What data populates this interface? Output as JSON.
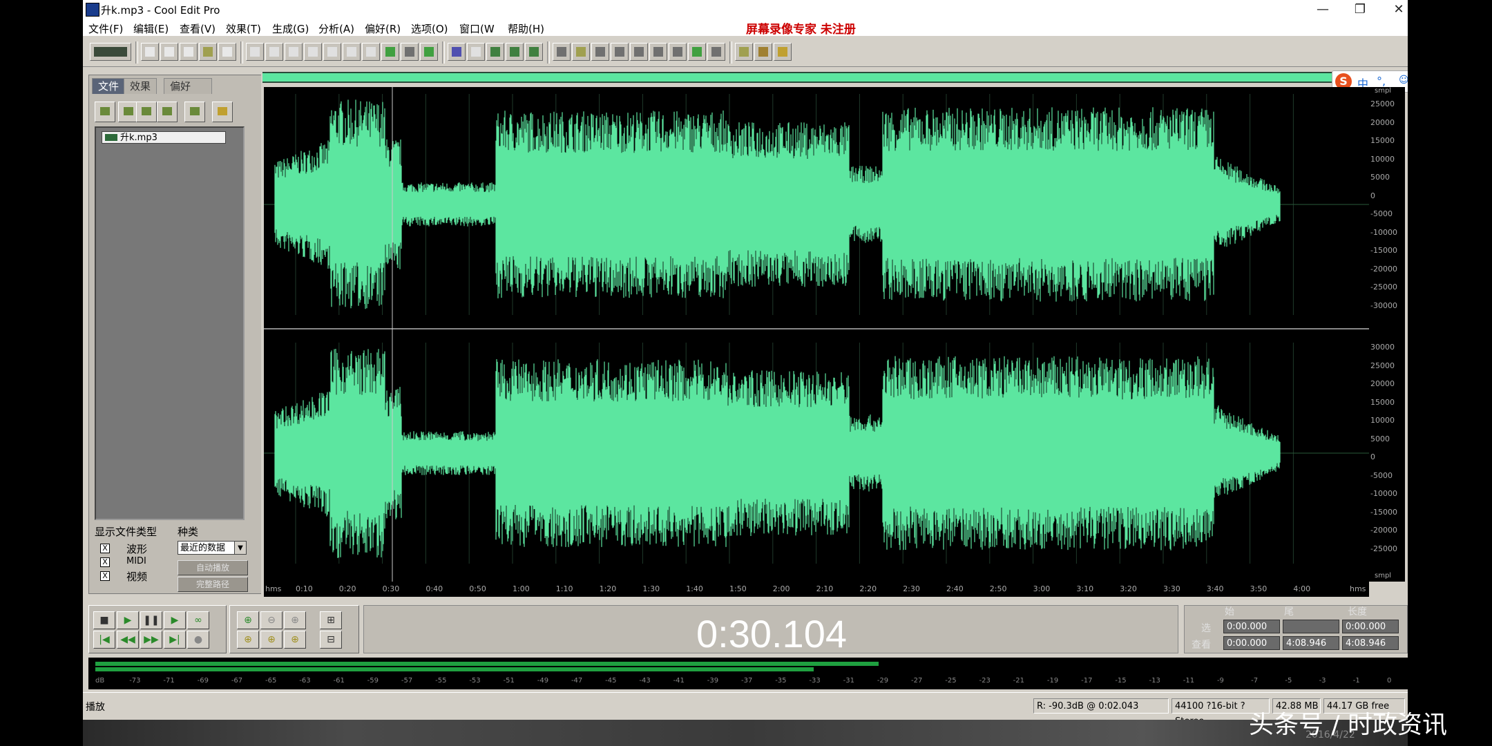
{
  "window": {
    "title": "升k.mp3 - Cool Edit Pro",
    "registration": "屏幕录像专家  未注册",
    "minimize": "—",
    "restore": "❐",
    "close": "✕"
  },
  "menu": [
    "文件(F)",
    "编辑(E)",
    "查看(V)",
    "效果(T)",
    "生成(G)",
    "分析(A)",
    "偏好(R)",
    "选项(O)",
    "窗口(W",
    "帮助(H)"
  ],
  "left_panel": {
    "tabs": [
      "文件",
      "效果",
      "偏好"
    ],
    "file_name": "升k.mp3",
    "show_types_label": "显示文件类型",
    "kind_label": "种类",
    "types": [
      {
        "label": "波形",
        "checked": "X"
      },
      {
        "label": "MIDI",
        "checked": "X"
      },
      {
        "label": "视频",
        "checked": "X"
      }
    ],
    "kind_select": "最近的数据",
    "auto_play_button": "自动播放",
    "full_path_button": "完整路径"
  },
  "ime": {
    "logo": "S",
    "mode": "中",
    "punct": "°,",
    "icons": [
      "☺",
      "🎤",
      "⌨",
      "👕",
      "🔧"
    ]
  },
  "scale_units": {
    "top": "smpl",
    "bottom": "smpl"
  },
  "amplitude_ticks_top": [
    "25000",
    "20000",
    "15000",
    "10000",
    "5000",
    "0",
    "-5000",
    "-10000",
    "-15000",
    "-20000",
    "-25000",
    "-30000"
  ],
  "amplitude_ticks_bottom": [
    "30000",
    "25000",
    "20000",
    "15000",
    "10000",
    "5000",
    "0",
    "-5000",
    "-10000",
    "-15000",
    "-20000",
    "-25000"
  ],
  "time_ruler": {
    "start": "hms",
    "end": "hms",
    "ticks": [
      "0:10",
      "0:20",
      "0:30",
      "0:40",
      "0:50",
      "1:00",
      "1:10",
      "1:20",
      "1:30",
      "1:40",
      "1:50",
      "2:00",
      "2:10",
      "2:20",
      "2:30",
      "2:40",
      "2:50",
      "3:00",
      "3:10",
      "3:20",
      "3:30",
      "3:40",
      "3:50",
      "4:00"
    ]
  },
  "transport": {
    "current_time": "0:30.104",
    "play_buttons": [
      "■",
      "▶",
      "❚❚",
      "▶",
      "∞",
      "|◀",
      "◀◀",
      "▶▶",
      "▶|",
      "●"
    ],
    "zoom_buttons": [
      "⊕",
      "⊖",
      "⊕",
      "⊞",
      "⊕",
      "⊕",
      "⊕",
      "⊟"
    ]
  },
  "selection": {
    "headers": {
      "start": "始",
      "end": "尾",
      "length": "长度"
    },
    "rows": [
      {
        "label": "选",
        "start": "0:00.000",
        "end": "",
        "length": "0:00.000"
      },
      {
        "label": "查看",
        "start": "0:00.000",
        "end": "4:08.946",
        "length": "4:08.946"
      }
    ]
  },
  "level_meter": {
    "ticks": [
      "dB",
      "-73",
      "-71",
      "-69",
      "-67",
      "-65",
      "-63",
      "-61",
      "-59",
      "-57",
      "-55",
      "-53",
      "-51",
      "-49",
      "-47",
      "-45",
      "-43",
      "-41",
      "-39",
      "-37",
      "-35",
      "-33",
      "-31",
      "-29",
      "-27",
      "-25",
      "-23",
      "-21",
      "-19",
      "-17",
      "-15",
      "-13",
      "-11",
      "-9",
      "-7",
      "-5",
      "-3",
      "-1",
      "0"
    ],
    "level_left": 0.6,
    "level_right": 0.55
  },
  "status": {
    "left": "播放",
    "cursor": "R: -90.3dB @  0:02.043",
    "format": "44100 ?16-bit ?Stereo",
    "size": "42.88 MB",
    "free": "44.17 GB free"
  },
  "taskbar": {
    "date": "2016/4/22"
  },
  "watermark": "头条号 / 时政资讯",
  "colors": {
    "wave": "#5ce6a0",
    "wave_bg": "#000000",
    "registration": "#cc0000"
  }
}
